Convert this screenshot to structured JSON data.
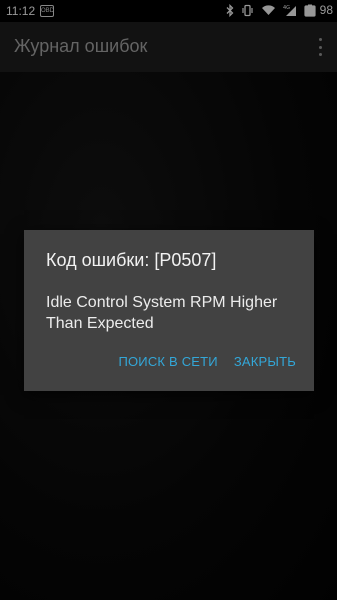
{
  "status_bar": {
    "time": "11:12",
    "notification_badge": "OBD",
    "icons": [
      "bluetooth-icon",
      "vibrate-icon",
      "wifi-icon",
      "cellular-4g-icon"
    ],
    "battery_level": "98",
    "network_label": "4G"
  },
  "app_bar": {
    "title": "Журнал ошибок",
    "menu_icon": "overflow-menu-icon"
  },
  "dialog": {
    "title": "Код ошибки: [P0507]",
    "message": "Idle Control System RPM Higher Than Expected",
    "search_button": "ПОИСК В СЕТИ",
    "close_button": "ЗАКРЫТЬ",
    "accent_color": "#33a7d8"
  }
}
